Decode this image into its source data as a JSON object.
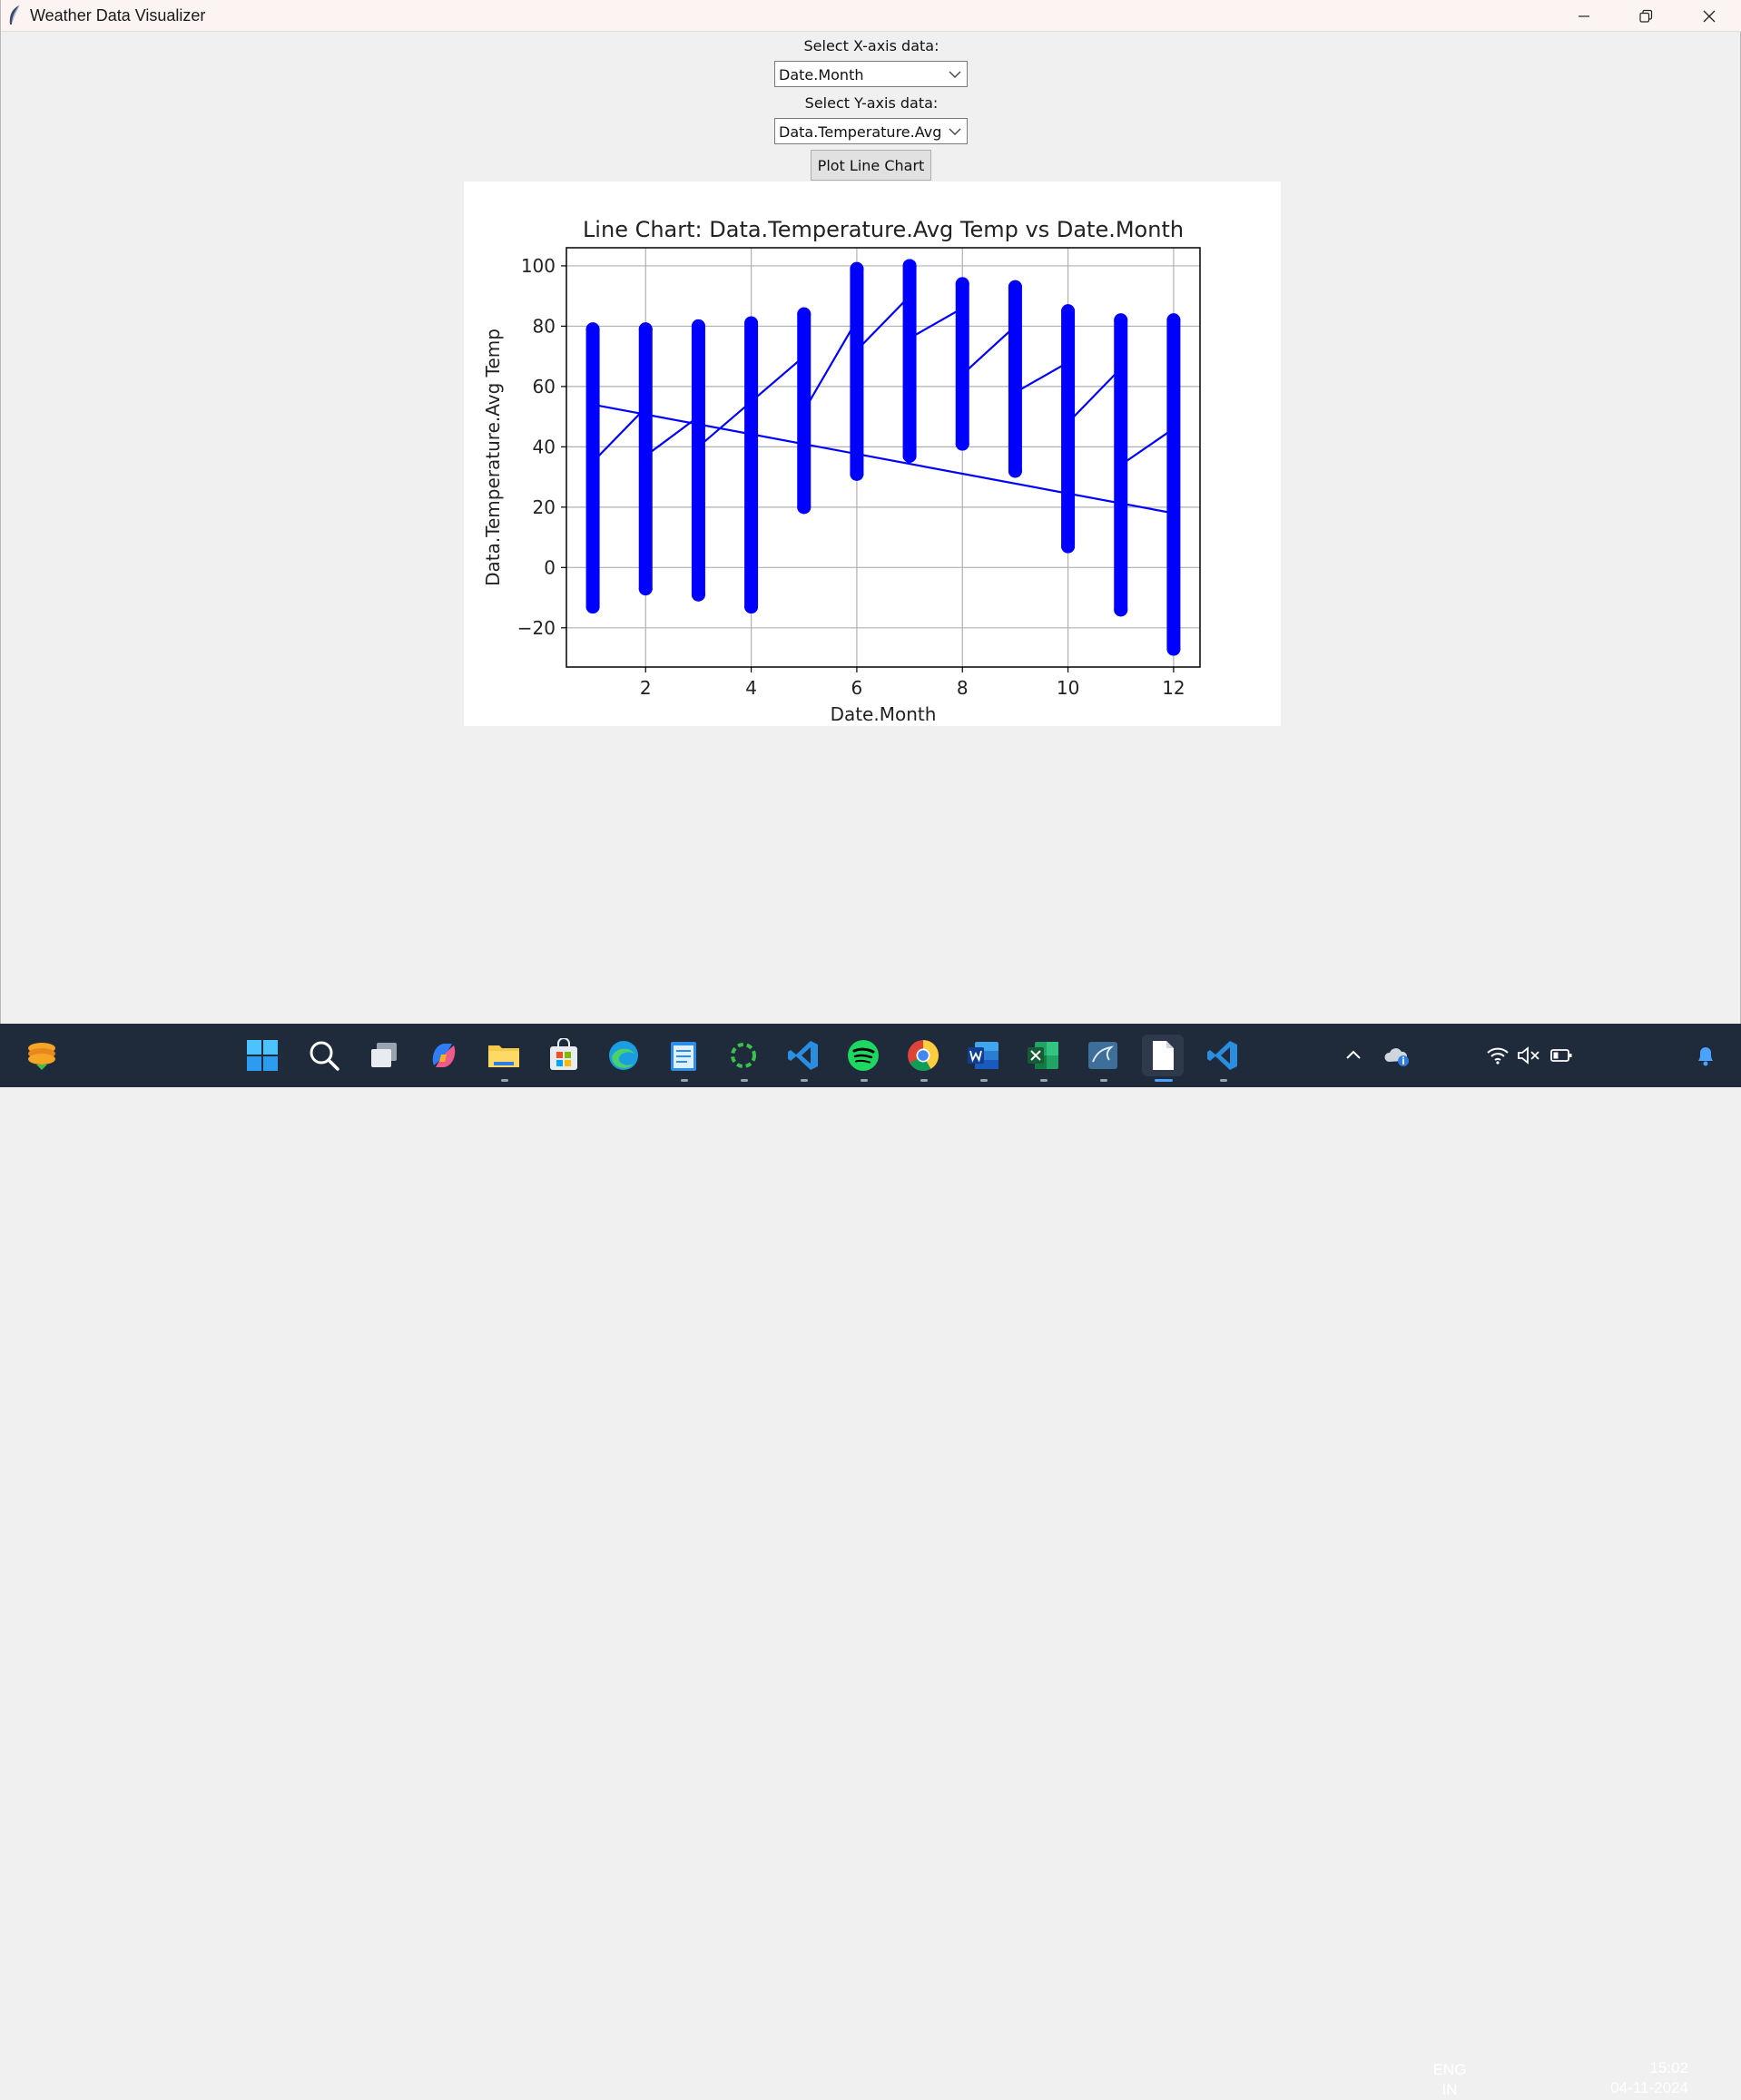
{
  "window": {
    "title": "Weather Data Visualizer"
  },
  "controls": {
    "x_label": "Select X-axis data:",
    "x_value": "Date.Month",
    "y_label": "Select Y-axis data:",
    "y_value": "Data.Temperature.Avg",
    "plot_button": "Plot Line Chart"
  },
  "chart_data": {
    "type": "line",
    "title": "Line Chart: Data.Temperature.Avg Temp vs Date.Month",
    "xlabel": "Date.Month",
    "ylabel": "Data.Temperature.Avg Temp",
    "xlim": [
      0.5,
      12.5
    ],
    "ylim": [
      -33,
      106
    ],
    "xticks": [
      2,
      4,
      6,
      8,
      10,
      12
    ],
    "yticks": [
      -20,
      0,
      20,
      40,
      60,
      80,
      100
    ],
    "grid": true,
    "color": "#0000ff",
    "month_ranges": [
      {
        "x": 1,
        "min": -13,
        "max": 79
      },
      {
        "x": 2,
        "min": -7,
        "max": 79
      },
      {
        "x": 3,
        "min": -9,
        "max": 80
      },
      {
        "x": 4,
        "min": -13,
        "max": 81
      },
      {
        "x": 5,
        "min": 20,
        "max": 84
      },
      {
        "x": 6,
        "min": 31,
        "max": 99
      },
      {
        "x": 7,
        "min": 37,
        "max": 100
      },
      {
        "x": 8,
        "min": 41,
        "max": 94
      },
      {
        "x": 9,
        "min": 32,
        "max": 93
      },
      {
        "x": 10,
        "min": 7,
        "max": 85
      },
      {
        "x": 11,
        "min": -14,
        "max": 82
      },
      {
        "x": 12,
        "min": -27,
        "max": 82
      }
    ],
    "line_path": [
      {
        "x": 1,
        "y": 35
      },
      {
        "x": 2,
        "y": 53
      },
      {
        "x": 2,
        "y": 37
      },
      {
        "x": 3,
        "y": 50
      },
      {
        "x": 3,
        "y": 40
      },
      {
        "x": 5,
        "y": 70
      },
      {
        "x": 5,
        "y": 52
      },
      {
        "x": 6,
        "y": 82
      },
      {
        "x": 6,
        "y": 72
      },
      {
        "x": 7,
        "y": 90
      },
      {
        "x": 7,
        "y": 76
      },
      {
        "x": 8,
        "y": 86
      },
      {
        "x": 8,
        "y": 64
      },
      {
        "x": 9,
        "y": 80
      },
      {
        "x": 9,
        "y": 58
      },
      {
        "x": 10,
        "y": 68
      },
      {
        "x": 10,
        "y": 48
      },
      {
        "x": 11,
        "y": 66
      },
      {
        "x": 11,
        "y": 34
      },
      {
        "x": 12,
        "y": 46
      },
      {
        "x": 12,
        "y": 18
      },
      {
        "x": 1,
        "y": 54
      }
    ]
  },
  "taskbar": {
    "apps": [
      {
        "name": "widgets-icon"
      },
      {
        "name": "start-icon"
      },
      {
        "name": "search-icon"
      },
      {
        "name": "task-view-icon"
      },
      {
        "name": "copilot-icon"
      },
      {
        "name": "file-explorer-icon"
      },
      {
        "name": "store-icon"
      },
      {
        "name": "edge-icon"
      },
      {
        "name": "notepad-icon"
      },
      {
        "name": "loading-app-icon"
      },
      {
        "name": "vscode-icon"
      },
      {
        "name": "spotify-icon"
      },
      {
        "name": "chrome-icon"
      },
      {
        "name": "word-icon"
      },
      {
        "name": "excel-icon"
      },
      {
        "name": "mysql-icon"
      },
      {
        "name": "blank-document-icon"
      },
      {
        "name": "vscode-icon-2"
      }
    ],
    "tray": {
      "lang_top": "ENG",
      "lang_bottom": "IN",
      "time": "15:02",
      "date": "04-11-2024"
    }
  }
}
